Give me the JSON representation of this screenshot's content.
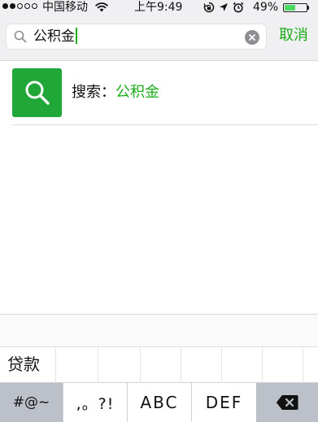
{
  "status_bar": {
    "carrier": "中国移动",
    "time": "上午9:49",
    "battery_percent": "49%",
    "battery_level": 0.49,
    "signal_strength": 2,
    "signal_total": 5,
    "icons": [
      "wifi-icon",
      "rotation-lock-icon",
      "location-arrow-icon",
      "alarm-icon",
      "battery-icon"
    ]
  },
  "search": {
    "value": "公积金",
    "clear_icon": "clear-circle-icon",
    "search_icon": "magnifier-icon",
    "cancel_label": "取消"
  },
  "suggestion": {
    "prefix": "搜索：",
    "keyword": "公积金",
    "icon": "search-icon"
  },
  "keyboard": {
    "candidates": [
      "贷款"
    ],
    "keys": {
      "symbols": "#@~",
      "punctuation": ",。?!",
      "abc": "ABC",
      "def": "DEF",
      "backspace_icon": "backspace-icon"
    }
  },
  "colors": {
    "accent_green": "#1aad19",
    "icon_tile_green": "#21a638",
    "battery_green": "#4cd964",
    "header_bg": "#f0f0f2",
    "keyboard_function_key": "#bcc0c8"
  }
}
